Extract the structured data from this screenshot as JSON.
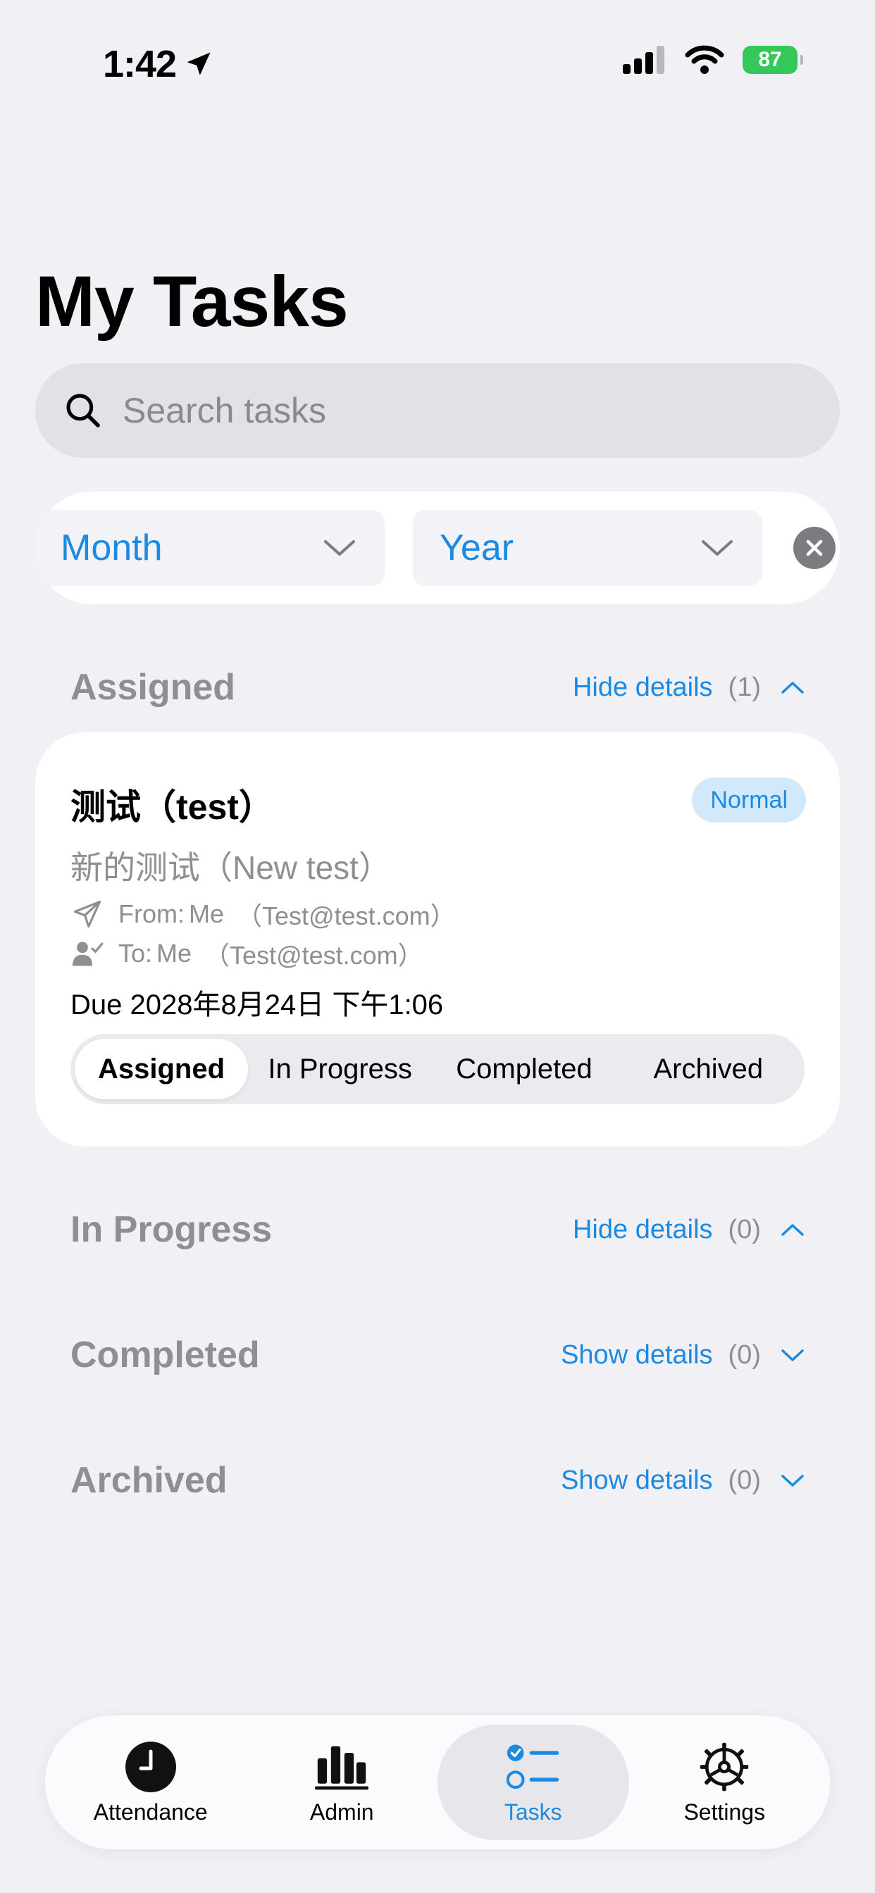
{
  "status_bar": {
    "time": "1:42",
    "battery": "87"
  },
  "page": {
    "title": "My Tasks"
  },
  "search": {
    "placeholder": "Search tasks"
  },
  "filters": {
    "month_label": "Month",
    "year_label": "Year"
  },
  "sections": {
    "assigned": {
      "title": "Assigned",
      "toggle": "Hide details",
      "count": "(1)"
    },
    "in_progress": {
      "title": "In Progress",
      "toggle": "Hide details",
      "count": "(0)"
    },
    "completed": {
      "title": "Completed",
      "toggle": "Show details",
      "count": "(0)"
    },
    "archived": {
      "title": "Archived",
      "toggle": "Show details",
      "count": "(0)"
    }
  },
  "task": {
    "title": "测试（test）",
    "priority": "Normal",
    "description": "新的测试（New test）",
    "from_label": "From:",
    "from_name": "Me",
    "from_email": "（Test@test.com）",
    "to_label": "To:",
    "to_name": "Me",
    "to_email": "（Test@test.com）",
    "due": "Due 2028年8月24日 下午1:06",
    "status_options": [
      "Assigned",
      "In Progress",
      "Completed",
      "Archived"
    ],
    "selected_status": "Assigned"
  },
  "tab_bar": {
    "tabs": [
      {
        "label": "Attendance",
        "icon": "clock-icon"
      },
      {
        "label": "Admin",
        "icon": "bar-chart-icon"
      },
      {
        "label": "Tasks",
        "icon": "checklist-icon"
      },
      {
        "label": "Settings",
        "icon": "gear-icon"
      }
    ],
    "active": "Tasks"
  },
  "colors": {
    "accent": "#1a8ae3",
    "background": "#f0f0f5",
    "secondary_text": "#8e8e93",
    "battery": "#34c759"
  }
}
